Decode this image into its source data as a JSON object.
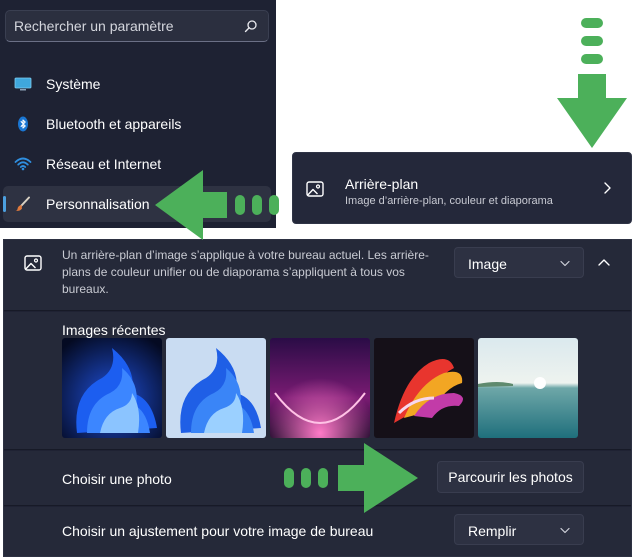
{
  "sidebar": {
    "search_placeholder": "Rechercher un paramètre",
    "items": [
      {
        "label": "Système",
        "icon": "monitor-icon",
        "selected": false
      },
      {
        "label": "Bluetooth et appareils",
        "icon": "bluetooth-icon",
        "selected": false
      },
      {
        "label": "Réseau et Internet",
        "icon": "wifi-icon",
        "selected": false
      },
      {
        "label": "Personnalisation",
        "icon": "paintbrush-icon",
        "selected": true
      }
    ]
  },
  "background_card": {
    "title": "Arrière-plan",
    "subtitle": "Image d’arrière-plan, couleur et diaporama",
    "icon": "picture-icon"
  },
  "background_settings": {
    "description": "Un arrière-plan d’image s’applique à votre bureau actuel. Les arrière-plans de couleur unifier ou de diaporama s’appliquent à tous vos bureaux.",
    "type_value": "Image",
    "recent_title": "Images récentes",
    "recent_images": [
      "bloom-blue-dark",
      "bloom-blue-light",
      "glow-purple",
      "ribbon-colorful",
      "lake-sunrise"
    ],
    "choose_photo_label": "Choisir une photo",
    "browse_button": "Parcourir les photos",
    "fit_label": "Choisir un ajustement pour votre image de bureau",
    "fit_value": "Remplir"
  },
  "colors": {
    "annotation_green": "#4cb05a",
    "accent": "#4ca0e0"
  }
}
